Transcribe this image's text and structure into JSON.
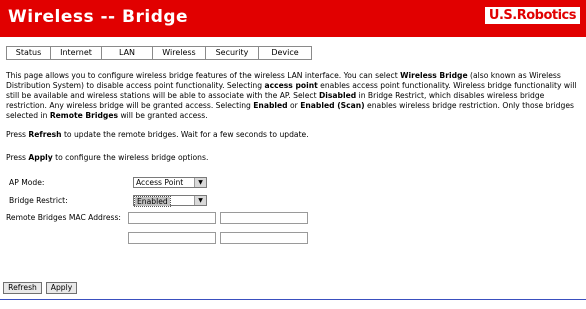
{
  "header": {
    "title": "Wireless -- Bridge",
    "logo": "U.S.Robotics",
    "brand_color": "#e10000"
  },
  "tabs": [
    {
      "label": "Status"
    },
    {
      "label": "Internet"
    },
    {
      "label": "LAN"
    },
    {
      "label": "Wireless"
    },
    {
      "label": "Security"
    },
    {
      "label": "Device"
    }
  ],
  "description": {
    "p1": "This page allows you to configure wireless bridge features of the wireless LAN interface. You can select ",
    "b1": "Wireless Bridge",
    "p2": " (also known as Wireless Distribution System) to disable access point functionality. Selecting ",
    "b2": "access point",
    "p3": " enables access point functionality. Wireless bridge functionality will still be available and wireless stations will be able to associate with the AP. Select ",
    "b3": "Disabled",
    "p4": " in Bridge Restrict, which disables wireless bridge restriction. Any wireless bridge will be granted access. Selecting ",
    "b4": "Enabled",
    "p5": " or ",
    "b5": "Enabled (Scan)",
    "p6": " enables wireless bridge restriction. Only those bridges selected in ",
    "b6": "Remote Bridges",
    "p7": " will be granted access."
  },
  "refresh_help": {
    "pre": "Press ",
    "bold": "Refresh",
    "post": " to update the remote bridges. Wait for a few seconds to update."
  },
  "apply_help": {
    "pre": "Press ",
    "bold": "Apply",
    "post": " to configure the wireless bridge options."
  },
  "form": {
    "ap_mode_label": "AP Mode:",
    "ap_mode_value": "Access Point",
    "bridge_restrict_label": "Bridge Restrict:",
    "bridge_restrict_value": "Enabled",
    "mac_label": "Remote Bridges MAC Address:",
    "mac_values": [
      "",
      "",
      "",
      ""
    ]
  },
  "buttons": {
    "refresh": "Refresh",
    "apply": "Apply"
  }
}
